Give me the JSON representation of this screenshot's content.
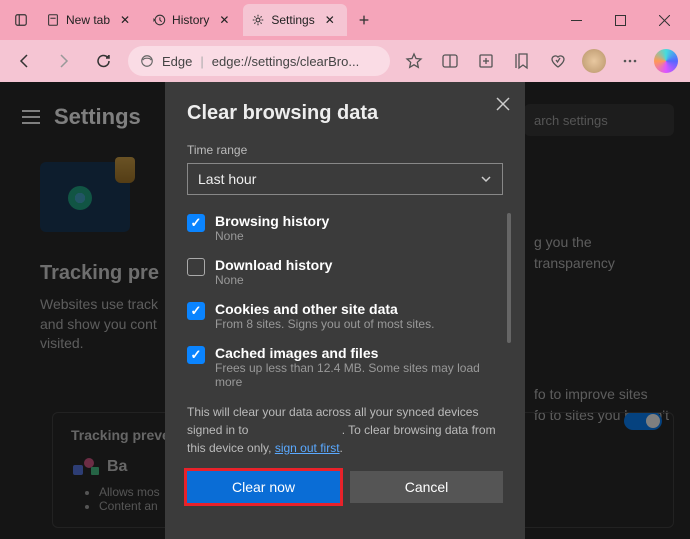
{
  "titlebar": {
    "tabs": [
      {
        "label": "New tab"
      },
      {
        "label": "History"
      },
      {
        "label": "Settings"
      }
    ]
  },
  "addressbar": {
    "brand": "Edge",
    "url": "edge://settings/clearBro..."
  },
  "settings": {
    "title": "Settings",
    "search_placeholder": "arch settings",
    "tracking_heading": "Tracking pre",
    "tracking_text": "Websites use track\nand show you cont\nvisited.",
    "right_text_1": "g you the transparency",
    "right_text_2": "fo to improve sites",
    "right_text_3": "fo to sites you haven't",
    "card_title": "Tracking preve",
    "card_sub": "Ba",
    "card_b1": "Allows mos",
    "card_b2": "Content an"
  },
  "dialog": {
    "title": "Clear browsing data",
    "time_label": "Time range",
    "time_value": "Last hour",
    "items": [
      {
        "title": "Browsing history",
        "sub": "None",
        "checked": true
      },
      {
        "title": "Download history",
        "sub": "None",
        "checked": false
      },
      {
        "title": "Cookies and other site data",
        "sub": "From 8 sites. Signs you out of most sites.",
        "checked": true
      },
      {
        "title": "Cached images and files",
        "sub": "Frees up less than 12.4 MB. Some sites may load more",
        "checked": true
      }
    ],
    "notice_pre": "This will clear your data across all your synced devices signed in to ",
    "notice_mid": ". To clear browsing data from this device only, ",
    "notice_link": "sign out first",
    "notice_end": ".",
    "clear_btn": "Clear now",
    "cancel_btn": "Cancel"
  }
}
